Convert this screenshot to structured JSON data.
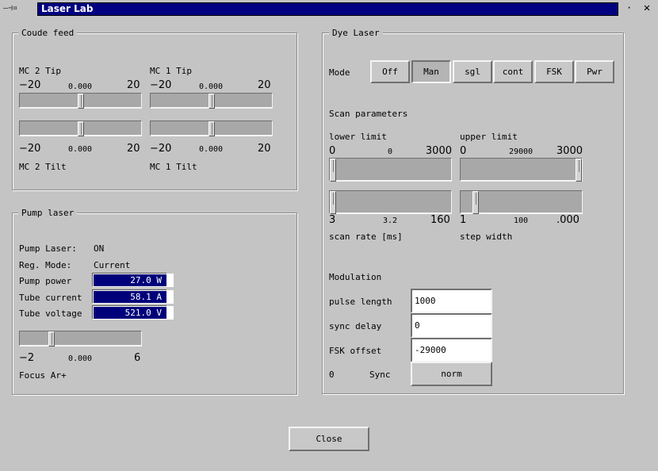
{
  "window": {
    "title": "Laser Lab",
    "menu_glyph": "—⊣¤",
    "dot_glyph": "·",
    "close_glyph": "✕"
  },
  "coude": {
    "title": "Coude feed",
    "mc2_tip": {
      "label": "MC 2 Tip",
      "min": "−20",
      "max": "20",
      "value": "0.000",
      "level": 0.5
    },
    "mc1_tip": {
      "label": "MC 1 Tip",
      "min": "−20",
      "max": "20",
      "value": "0.000",
      "level": 0.5
    },
    "mc2_tilt": {
      "label": "MC 2 Tilt",
      "min": "−20",
      "max": "20",
      "value": "0.000",
      "level": 0.5
    },
    "mc1_tilt": {
      "label": "MC 1 Tilt",
      "min": "−20",
      "max": "20",
      "value": "0.000",
      "level": 0.5
    }
  },
  "pump": {
    "title": "Pump laser",
    "laser_label": "Pump Laser:",
    "laser_value": "ON",
    "reg_label": "Reg. Mode:",
    "reg_value": "Current",
    "power_label": "Pump power",
    "power_value": "27.0 W",
    "current_label": "Tube current",
    "current_value": "58.1 A",
    "voltage_label": "Tube voltage",
    "voltage_value": "521.0 V",
    "focus": {
      "label": "Focus Ar+",
      "min": "−2",
      "max": "6",
      "value": "0.000",
      "level": 0.25
    }
  },
  "dye": {
    "title": "Dye Laser",
    "mode_label": "Mode",
    "modes": [
      "Off",
      "Man",
      "sgl",
      "cont",
      "FSK",
      "Pwr"
    ],
    "active_mode": "Man",
    "scan_title": "Scan parameters",
    "lower": {
      "label": "lower limit",
      "min": "0",
      "max": "3000",
      "value": "0",
      "level": 0.0
    },
    "upper": {
      "label": "upper limit",
      "min": "0",
      "max": "3000",
      "value": "29000",
      "level": 1.0
    },
    "rate": {
      "label": "scan rate [ms]",
      "min": "3",
      "max": "160",
      "value": "3.2",
      "level": 0.0
    },
    "step": {
      "label": "step width",
      "min": "1",
      "max": ".000",
      "value": "100",
      "level": 0.1
    },
    "mod_title": "Modulation",
    "pulse_label": "pulse length",
    "pulse_value": "1000",
    "sync_delay_label": "sync delay",
    "sync_delay_value": "0",
    "fsk_label": "FSK offset",
    "fsk_value": "-29000",
    "sync_count": "0",
    "sync_label": "Sync",
    "sync_button": "norm"
  },
  "close_button": "Close"
}
